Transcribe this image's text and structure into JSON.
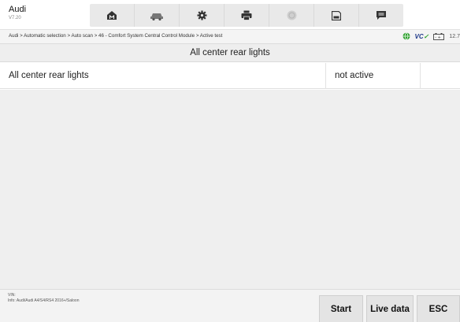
{
  "app": {
    "name": "Audi",
    "version": "V7.20"
  },
  "toolbar": {
    "icons": [
      "home-icon",
      "vehicle-icon",
      "settings-icon",
      "print-icon",
      "help-icon",
      "save-icon",
      "message-icon"
    ]
  },
  "breadcrumb": {
    "text": "Audi > Automatic selection > Auto scan > 46 - Comfort System Central Control Module > Active test"
  },
  "status": {
    "vci_prefix": "VC",
    "battery": "12.7"
  },
  "page": {
    "title": "All center rear lights"
  },
  "row": {
    "name": "All center rear lights",
    "value": "not active"
  },
  "footer": {
    "vin": "VIN:",
    "info": "Info: Audi/Audi A4/S4/RS4 2016+/Saloon",
    "start_label": "Start",
    "live_label": "Live data",
    "esc_label": "ESC"
  },
  "colors": {
    "vci_blue": "#1f3a8a",
    "vci_green": "#2ca02c",
    "globe_green": "#2ca02c"
  }
}
